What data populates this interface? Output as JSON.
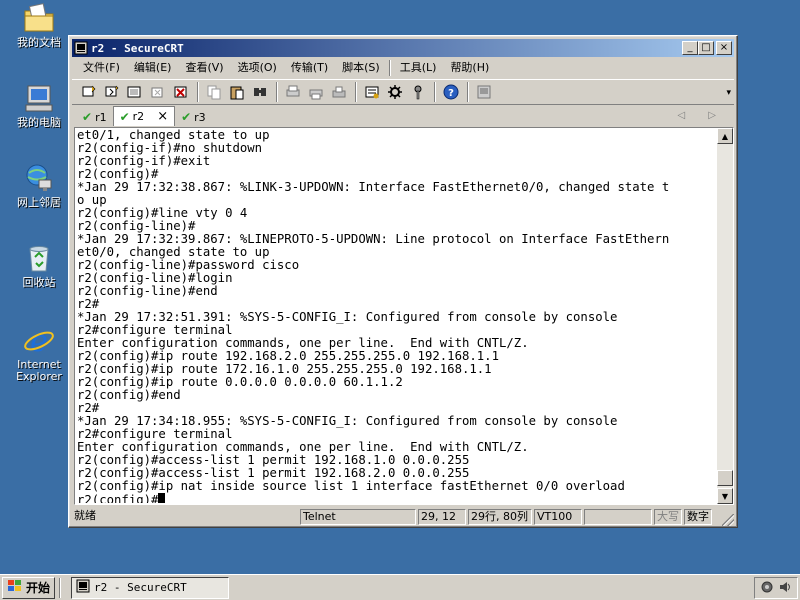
{
  "desktop": {
    "icons": [
      {
        "label": "我的文档",
        "icon": "my-documents-icon"
      },
      {
        "label": "我的电脑",
        "icon": "my-computer-icon"
      },
      {
        "label": "网上邻居",
        "icon": "network-places-icon"
      },
      {
        "label": "回收站",
        "icon": "recycle-bin-icon"
      },
      {
        "label": "Internet Explorer",
        "icon": "internet-explorer-icon"
      }
    ],
    "background": "#3a6ea5"
  },
  "window": {
    "title": "r2 - SecureCRT",
    "minimize": "_",
    "maximize": "□",
    "close": "×"
  },
  "menu": {
    "file": "文件(F)",
    "edit": "编辑(E)",
    "view": "查看(V)",
    "options": "选项(O)",
    "transfer": "传输(T)",
    "script": "脚本(S)",
    "tools": "工具(L)",
    "help": "帮助(H)"
  },
  "tabs": [
    {
      "label": "r1",
      "active": false
    },
    {
      "label": "r2",
      "active": true,
      "close": "×"
    },
    {
      "label": "r3",
      "active": false
    }
  ],
  "tab_arrows": "◁ ▷",
  "terminal": {
    "lines": [
      "et0/1, changed state to up",
      "r2(config-if)#no shutdown",
      "r2(config-if)#exit",
      "r2(config)#",
      "*Jan 29 17:32:38.867: %LINK-3-UPDOWN: Interface FastEthernet0/0, changed state t",
      "o up",
      "r2(config)#line vty 0 4",
      "r2(config-line)#",
      "*Jan 29 17:32:39.867: %LINEPROTO-5-UPDOWN: Line protocol on Interface FastEthern",
      "et0/0, changed state to up",
      "r2(config-line)#password cisco",
      "r2(config-line)#login",
      "r2(config-line)#end",
      "r2#",
      "*Jan 29 17:32:51.391: %SYS-5-CONFIG_I: Configured from console by console",
      "r2#configure terminal",
      "Enter configuration commands, one per line.  End with CNTL/Z.",
      "r2(config)#ip route 192.168.2.0 255.255.255.0 192.168.1.1",
      "r2(config)#ip route 172.16.1.0 255.255.255.0 192.168.1.1",
      "r2(config)#ip route 0.0.0.0 0.0.0.0 60.1.1.2",
      "r2(config)#end",
      "r2#",
      "*Jan 29 17:34:18.955: %SYS-5-CONFIG_I: Configured from console by console",
      "r2#configure terminal",
      "Enter configuration commands, one per line.  End with CNTL/Z.",
      "r2(config)#access-list 1 permit 192.168.1.0 0.0.0.255",
      "r2(config)#access-list 1 permit 192.168.2.0 0.0.0.255",
      "r2(config)#ip nat inside source list 1 interface fastEthernet 0/0 overload",
      "r2(config)#"
    ]
  },
  "status": {
    "ready": "就绪",
    "protocol": "Telnet",
    "cursor_pos": "29, 12",
    "size": "29行, 80列",
    "emulation": "VT100",
    "caps": "大写",
    "num": "数字"
  },
  "taskbar": {
    "start": "开始",
    "task_title": "r2 - SecureCRT"
  }
}
